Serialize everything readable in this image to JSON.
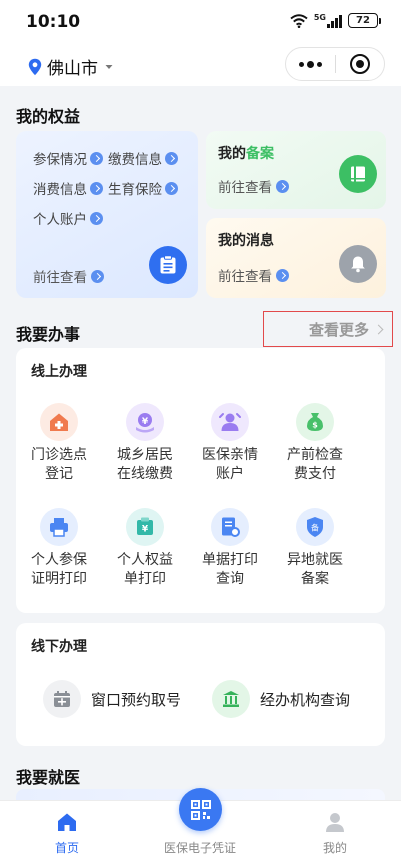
{
  "status": {
    "time": "10:10",
    "network": "5G",
    "battery": "72"
  },
  "topbar": {
    "city": "佛山市"
  },
  "rights": {
    "title": "我的权益",
    "left_items": [
      "参保情况",
      "缴费信息",
      "消费信息",
      "生育保险",
      "个人账户"
    ],
    "left_goto": "前往查看",
    "record_title_a": "我的",
    "record_title_b": "备案",
    "record_goto": "前往查看",
    "msg_title": "我的消息",
    "msg_goto": "前往查看"
  },
  "business": {
    "title": "我要办事",
    "more": "查看更多"
  },
  "online": {
    "title": "线上办理",
    "items": [
      {
        "l1": "门诊选点",
        "l2": "登记",
        "icon": "clinic-icon"
      },
      {
        "l1": "城乡居民",
        "l2": "在线缴费",
        "icon": "payment-icon"
      },
      {
        "l1": "医保亲情",
        "l2": "账户",
        "icon": "family-account-icon"
      },
      {
        "l1": "产前检查",
        "l2": "费支付",
        "icon": "prenatal-fee-icon"
      },
      {
        "l1": "个人参保",
        "l2": "证明打印",
        "icon": "printer-icon"
      },
      {
        "l1": "个人权益",
        "l2": "单打印",
        "icon": "rights-print-icon"
      },
      {
        "l1": "单据打印",
        "l2": "查询",
        "icon": "receipt-query-icon"
      },
      {
        "l1": "异地就医",
        "l2": "备案",
        "icon": "remote-record-icon"
      }
    ]
  },
  "offline": {
    "title": "线下办理",
    "items": [
      {
        "label": "窗口预约取号",
        "icon": "appointment-icon"
      },
      {
        "label": "经办机构查询",
        "icon": "institution-icon"
      }
    ]
  },
  "medical": {
    "title": "我要就医"
  },
  "tabs": [
    {
      "label": "首页",
      "icon": "home-icon"
    },
    {
      "label": "医保电子凭证",
      "icon": "qr-code-icon"
    },
    {
      "label": "我的",
      "icon": "profile-icon"
    }
  ],
  "colors": {
    "accent": "#2d6bf0",
    "highlight_border": "#e2494b",
    "green": "#3cbf64"
  }
}
